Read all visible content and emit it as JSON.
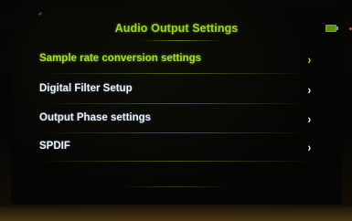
{
  "header": {
    "title": "Audio Output Settings",
    "battery_icon": "battery-icon"
  },
  "menu": {
    "items": [
      {
        "label": "Sample rate conversion settings",
        "selected": true,
        "icon": "chevron-right-icon"
      },
      {
        "label": "Digital Filter Setup",
        "selected": false,
        "icon": "chevron-right-icon"
      },
      {
        "label": "Output Phase settings",
        "selected": false,
        "icon": "chevron-right-icon"
      },
      {
        "label": "SPDIF",
        "selected": false,
        "icon": "chevron-right-icon"
      }
    ]
  },
  "glyphs": {
    "chevron": "›"
  },
  "colors": {
    "accent": "#a6de2e",
    "text": "#e8f0ff",
    "background": "#050503"
  }
}
